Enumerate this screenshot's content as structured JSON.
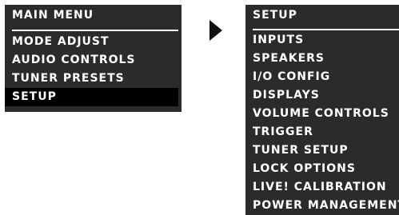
{
  "main_menu": {
    "title": "MAIN MENU",
    "items": [
      {
        "label": "MODE ADJUST"
      },
      {
        "label": "AUDIO CONTROLS"
      },
      {
        "label": "TUNER PRESETS"
      },
      {
        "label": "SETUP",
        "selected": true
      }
    ]
  },
  "setup_menu": {
    "title": "SETUP",
    "items": [
      {
        "label": "INPUTS"
      },
      {
        "label": "SPEAKERS"
      },
      {
        "label": "I/O CONFIG"
      },
      {
        "label": "DISPLAYS"
      },
      {
        "label": "VOLUME CONTROLS"
      },
      {
        "label": "TRIGGER"
      },
      {
        "label": "TUNER SETUP"
      },
      {
        "label": "LOCK OPTIONS"
      },
      {
        "label": "LIVE! CALIBRATION"
      },
      {
        "label": "POWER MANAGEMENT"
      }
    ]
  },
  "arrow": {
    "icon": "triangle-right-icon"
  },
  "colors": {
    "panel_background": "#2b2b2b",
    "text": "#ffffff",
    "selection_background": "#000000",
    "arrow": "#111111"
  }
}
